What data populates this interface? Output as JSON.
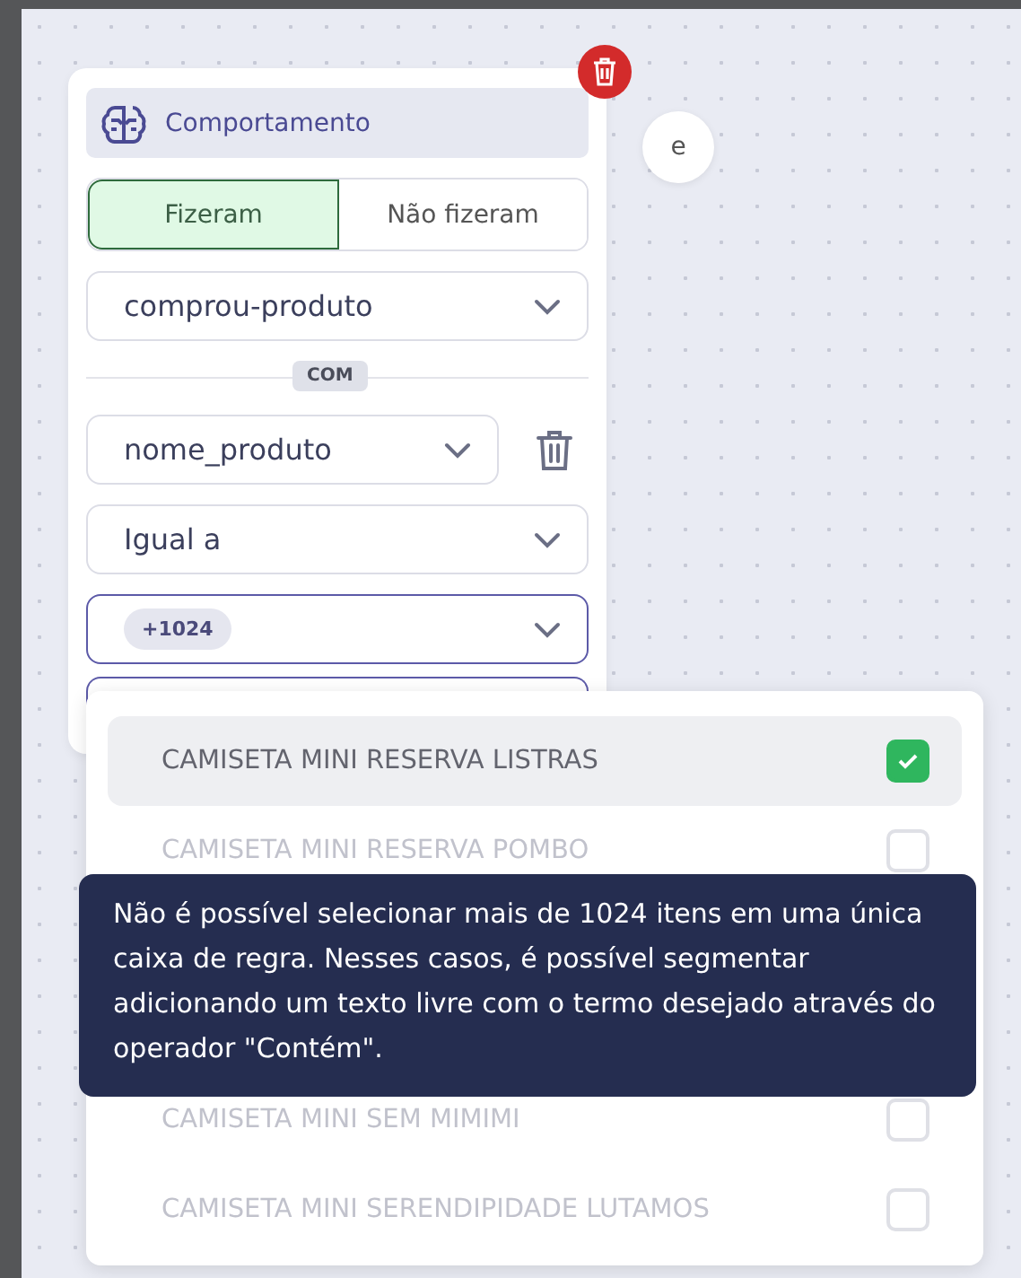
{
  "card": {
    "title": "Comportamento",
    "toggle": [
      {
        "label": "Fizeram",
        "selected": true
      },
      {
        "label": "Não fizeram",
        "selected": false
      }
    ],
    "event_select": {
      "value": "comprou-produto"
    },
    "divider_label": "COM",
    "property_select": {
      "value": "nome_produto"
    },
    "operator_select": {
      "value": "Igual a"
    },
    "values_select": {
      "chip": "+1024",
      "focused": true
    }
  },
  "connector": {
    "label": "e"
  },
  "dropdown": {
    "options": [
      {
        "label": "CAMISETA MINI RESERVA LISTRAS",
        "checked": true
      },
      {
        "label": "CAMISETA MINI RESERVA POMBO",
        "checked": false
      },
      {
        "label": "CAMISETA MINI SEM MIMIMI",
        "checked": false
      },
      {
        "label": "CAMISETA MINI SERENDIPIDADE LUTAMOS",
        "checked": false
      }
    ]
  },
  "tooltip": {
    "text": "Não é possível selecionar mais de 1024 itens em uma única caixa de regra. Nesses casos, é possível segmentar adicionando um texto livre com o termo desejado através do operador \"Contém\"."
  }
}
